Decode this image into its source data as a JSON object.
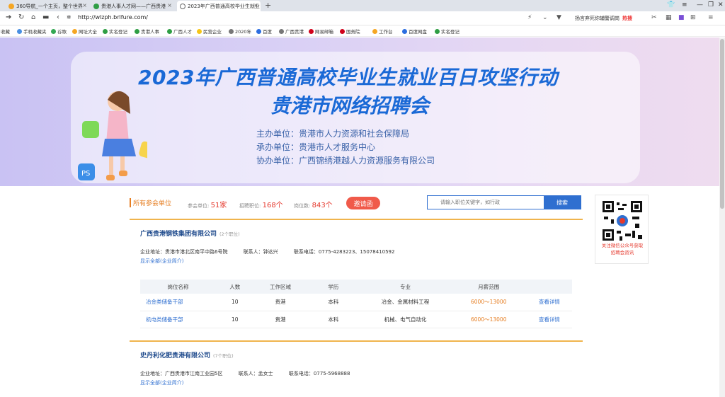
{
  "browser": {
    "tabs": [
      {
        "title": "360导航_一个主页，整个世界",
        "icon_color": "#f5a623"
      },
      {
        "title": "贵港人事人才网——广西贵港",
        "icon_color": "#2f9e44"
      },
      {
        "title": "2023年广西普通高校毕业生就业",
        "icon_color": "#666666"
      }
    ],
    "url": "http://wlzph.brlfure.com/",
    "search_text": "扬言弃死你辅警调岗",
    "search_hot": "热搜",
    "bookmarks": [
      "收藏",
      "手机收藏夹",
      "谷歌",
      "网址大全",
      "实名登记",
      "贵港人事",
      "广西人才",
      "民营企业",
      "2020年",
      "百度",
      "广西贵港",
      "网易邮箱",
      "国务院",
      "工作台",
      "百度网盘",
      "实名登记"
    ]
  },
  "banner": {
    "title_line1": "2023年广西普通高校毕业生就业百日攻坚行动",
    "title_line2": "贵港市网络招聘会",
    "organizers": [
      "主办单位：贵港市人力资源和社会保障局",
      "承办单位：贵港市人才服务中心",
      "协办单位：广西锦绣港越人力资源服务有限公司"
    ]
  },
  "stats": {
    "section_title": "所有参会单位",
    "company_label": "参会单位:",
    "company_value": "51家",
    "jobs_label": "招聘职位:",
    "jobs_value": "168个",
    "positions_label": "岗位数:",
    "positions_value": "843个",
    "invite_label": "邀请函"
  },
  "job_search": {
    "placeholder": "请输入职位关键字，如行政",
    "button": "搜索"
  },
  "qr": {
    "caption_line1": "关注微信公众号获取",
    "caption_line2": "招聘会资讯"
  },
  "table_headers": [
    "岗位名称",
    "人数",
    "工作区域",
    "学历",
    "专业",
    "月薪范围",
    ""
  ],
  "companies": [
    {
      "name": "广西贵港钢铁集团有限公司",
      "job_count": "(2个职位)",
      "address": "企业地址：贵港市港北区南平中路6号院",
      "contact": "联系人：钟达兴",
      "phone": "联系电话：0775-4283223、15078410592",
      "show_all": "显示全部(企业简介)",
      "jobs": [
        {
          "title": "冶金类储备干部",
          "count": "10",
          "area": "贵港",
          "edu": "本科",
          "major": "冶金、金属材料工程",
          "salary": "6000～13000",
          "detail": "查看详情"
        },
        {
          "title": "机电类储备干部",
          "count": "10",
          "area": "贵港",
          "edu": "本科",
          "major": "机械、电气自动化",
          "salary": "6000～13000",
          "detail": "查看详情"
        }
      ]
    },
    {
      "name": "史丹利化肥贵港有限公司",
      "job_count": "(7个职位)",
      "address": "企业地址：广西贵港市江南工业园5区",
      "contact": "联系人：孟女士",
      "phone": "联系电话：0775-5968888",
      "show_all": "显示全部(企业简介)"
    }
  ]
}
